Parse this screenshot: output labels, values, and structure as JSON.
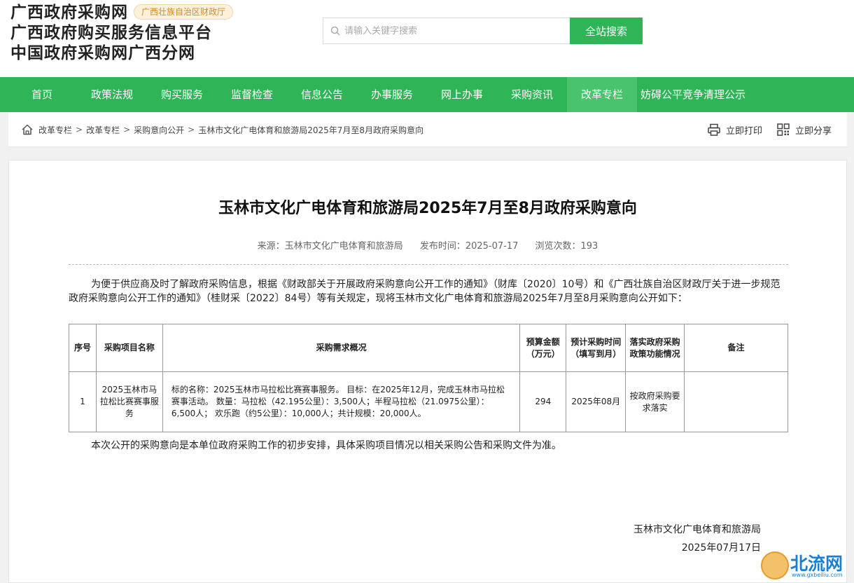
{
  "header": {
    "site_lines": [
      "广西政府采购网",
      "广西政府购买服务信息平台",
      "中国政府采购网广西分网"
    ],
    "badge": "广西壮族自治区财政厅",
    "search_placeholder": "请输入关键字搜索",
    "search_button": "全站搜索"
  },
  "nav": {
    "items": [
      "首页",
      "政策法规",
      "购买服务",
      "监督检查",
      "信息公告",
      "办事服务",
      "网上办事",
      "采购资讯",
      "改革专栏",
      "妨碍公平竞争清理公示"
    ],
    "active_index": 8
  },
  "breadcrumb": {
    "items": [
      "改革专栏",
      "改革专栏",
      "采购意向公开",
      "玉林市文化广电体育和旅游局2025年7月至8月政府采购意向"
    ],
    "sep": ">"
  },
  "tools": {
    "print": "立即打印",
    "share": "立即分享"
  },
  "article": {
    "title": "玉林市文化广电体育和旅游局2025年7月至8月政府采购意向",
    "source": "来源：玉林市文化广电体育和旅游局",
    "publish_time": "发布时间：2025-07-17",
    "views": "浏览次数：193",
    "intro": "为便于供应商及时了解政府采购信息，根据《财政部关于开展政府采购意向公开工作的通知》（财库〔2020〕10号）和《广西壮族自治区财政厅关于进一步规范政府采购意向公开工作的通知》（桂财采〔2022〕84号）等有关规定，现将玉林市文化广电体育和旅游局2025年7月至8月采购意向公开如下：",
    "table": {
      "headers": [
        "序号",
        "采购项目名称",
        "采购需求概况",
        "预算金额（万元）",
        "预计采购时间（填写到月）",
        "落实政府采购政策功能情况",
        "备注"
      ],
      "rows": [
        [
          "1",
          "2025玉林市马拉松比赛赛事服务",
          "标的名称：2025玉林市马拉松比赛赛事服务。 目标：在2025年12月，完成玉林市马拉松赛事活动。 数量：马拉松（42.195公里）：3,500人；半程马拉松（21.0975公里）：6,500人； 欢乐跑（约5公里）：10,000人；共计规模：20,000人。",
          "294",
          "2025年08月",
          "按政府采购要求落实",
          ""
        ]
      ]
    },
    "outro": "本次公开的采购意向是本单位政府采购工作的初步安排，具体采购项目情况以相关采购公告和采购文件为准。",
    "sign_org": "玉林市文化广电体育和旅游局",
    "sign_date": "2025年07月17日"
  },
  "watermark": {
    "text": "北流网",
    "url": "www.gxbeiliu.com"
  },
  "colors": {
    "brand_green": "#2fb557",
    "active_green": "#49c36c",
    "badge_orange": "#d48a1b"
  }
}
